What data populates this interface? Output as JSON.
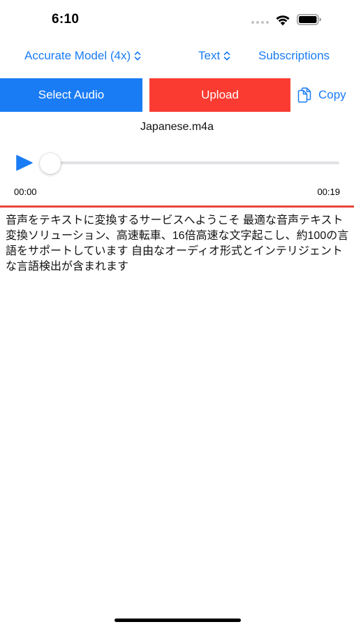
{
  "status_bar": {
    "time": "6:10"
  },
  "nav": {
    "model_label": "Accurate Model (4x)",
    "format_label": "Text",
    "subscriptions_label": "Subscriptions"
  },
  "actions": {
    "select_audio_label": "Select Audio",
    "upload_label": "Upload",
    "copy_label": "Copy"
  },
  "player": {
    "file_name": "Japanese.m4a",
    "current_time": "00:00",
    "duration": "00:19",
    "progress_fraction": 0
  },
  "transcript": {
    "text": "音声をテキストに変換するサービスへようこそ 最適な音声テキスト変換ソリューション、高速転車、16倍高速な文字起こし、約100の言語をサポートしています 自由なオーディオ形式とインテリジェントな言語検出が含まれます"
  },
  "colors": {
    "accent_blue": "#1a7cf5",
    "upload_red": "#fa3b32",
    "divider_red": "#e8463c"
  },
  "icons": {
    "wifi": "wifi-icon",
    "battery": "battery-icon",
    "chevron": "chevron-up-down-icon",
    "copy": "copy-icon",
    "play": "play-icon"
  }
}
